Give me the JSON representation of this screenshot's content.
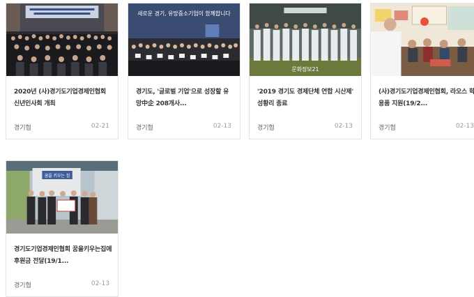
{
  "posts": [
    {
      "title": "2020년 (사)경기도기업경제인협회 신년인사회 개최",
      "author": "경기협",
      "date": "02-21"
    },
    {
      "title": "경기도, '글로벌 기업'으로 성장할 유망中企 208개사...",
      "author": "경기협",
      "date": "02-13",
      "image_text": "새로운 경기, 유망중소기업이 함께합니다"
    },
    {
      "title": "'2019 경기도 경제단체 연합 시산제' 성황리 종료",
      "author": "경기협",
      "date": "02-13",
      "image_text": "문화정보21"
    },
    {
      "title": "(사)경기도기업경제인협회, 라오스 학용품 지원(19/2...",
      "author": "경기협",
      "date": "02-13"
    },
    {
      "title": "경기도기업경제인협회 꿈을키우는집에 후원금 전달(19/1...",
      "author": "경기협",
      "date": "02-13",
      "image_text": "꿈을 키우는 집"
    }
  ]
}
